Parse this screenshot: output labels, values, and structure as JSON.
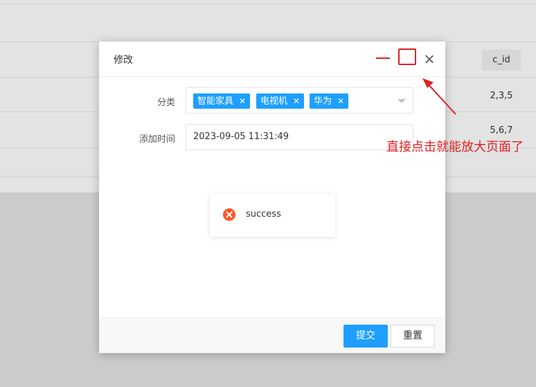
{
  "background_table": {
    "header": "c_id",
    "rows": [
      "2,3,5",
      "5,6,7"
    ]
  },
  "dialog": {
    "title": "修改",
    "fields": {
      "category_label": "分类",
      "category_tags": [
        "智能家具",
        "电视机",
        "华为"
      ],
      "time_label": "添加时间",
      "time_value": "2023-09-05 11:31:49"
    },
    "toast": {
      "text": "success"
    },
    "buttons": {
      "submit": "提交",
      "reset": "重置"
    }
  },
  "annotation": {
    "text": "直接点击就能放大页面了"
  },
  "colors": {
    "primary": "#1e9fff",
    "annotation": "#e02020",
    "error": "#ff5722"
  }
}
